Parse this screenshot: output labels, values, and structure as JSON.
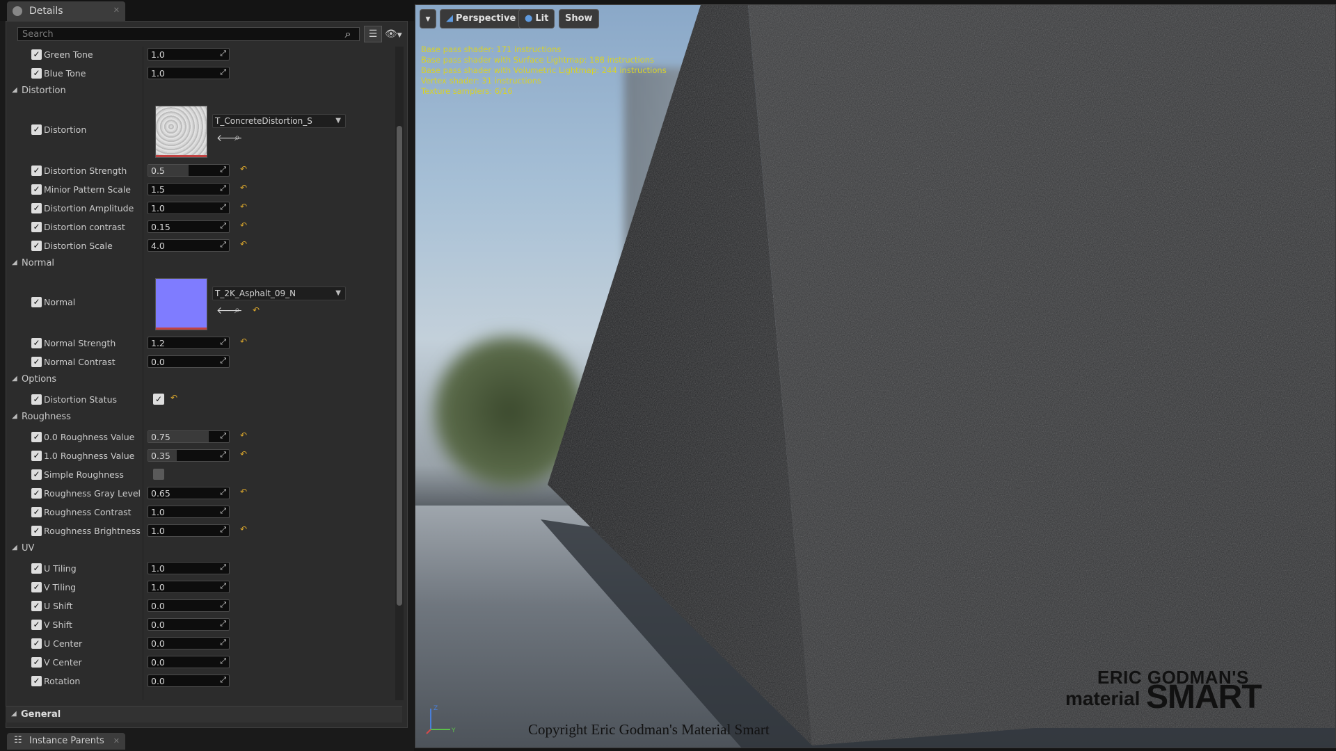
{
  "tabs": {
    "details": "Details",
    "instance_parents": "Instance Parents"
  },
  "search": {
    "placeholder": "Search"
  },
  "general": "General",
  "rows": [
    {
      "label": "Green Tone",
      "value": "1.0"
    },
    {
      "label": "Blue Tone",
      "value": "1.0"
    }
  ],
  "categories": {
    "distortion": "Distortion",
    "normal": "Normal",
    "options": "Options",
    "roughness": "Roughness",
    "uv": "UV"
  },
  "textures": {
    "distortion": {
      "label": "Distortion",
      "name": "T_ConcreteDistortion_S"
    },
    "normal": {
      "label": "Normal",
      "name": "T_2K_Asphalt_09_N"
    }
  },
  "distortion_params": [
    {
      "label": "Distortion Strength",
      "value": "0.5",
      "slider": 0.5
    },
    {
      "label": "Minior Pattern Scale",
      "value": "1.5"
    },
    {
      "label": "Distortion Amplitude",
      "value": "1.0"
    },
    {
      "label": "Distortion contrast",
      "value": "0.15"
    },
    {
      "label": "Distortion Scale",
      "value": "4.0"
    }
  ],
  "normal_params": [
    {
      "label": "Normal Strength",
      "value": "1.2"
    },
    {
      "label": "Normal Contrast",
      "value": "0.0"
    }
  ],
  "options_params": [
    {
      "label": "Distortion Status",
      "checked": true
    }
  ],
  "roughness_params": [
    {
      "label": "0.0 Roughness Value",
      "value": "0.75",
      "slider": 0.75
    },
    {
      "label": "1.0 Roughness Value",
      "value": "0.35",
      "slider": 0.35
    },
    {
      "label": "Simple Roughness",
      "checked": false
    },
    {
      "label": "Roughness Gray Level",
      "value": "0.65"
    },
    {
      "label": "Roughness Contrast",
      "value": "1.0"
    },
    {
      "label": "Roughness Brightness",
      "value": "1.0"
    }
  ],
  "uv_params": [
    {
      "label": "U Tiling",
      "value": "1.0"
    },
    {
      "label": "V Tiling",
      "value": "1.0"
    },
    {
      "label": "U Shift",
      "value": "0.0"
    },
    {
      "label": "V Shift",
      "value": "0.0"
    },
    {
      "label": "U Center",
      "value": "0.0"
    },
    {
      "label": "V Center",
      "value": "0.0"
    },
    {
      "label": "Rotation",
      "value": "0.0"
    }
  ],
  "viewport": {
    "perspective": "Perspective",
    "lit": "Lit",
    "show": "Show",
    "stats": [
      "Base pass shader: 171 instructions",
      "Base pass shader with Surface Lightmap: 188 instructions",
      "Base pass shader with Volumetric Lightmap: 244 instructions",
      "Vertex shader: 31 instructions",
      "Texture samplers: 6/16"
    ],
    "brand_line1": "ERIC GODMAN'S",
    "brand_line2": "material",
    "brand_line3": "SMART",
    "copyright": "Copyright Eric Godman's Material Smart"
  },
  "colors": {
    "accent_reset": "#d9a62c",
    "normal_thumb": "#7f7cff",
    "stats_text": "#d7d12a"
  }
}
